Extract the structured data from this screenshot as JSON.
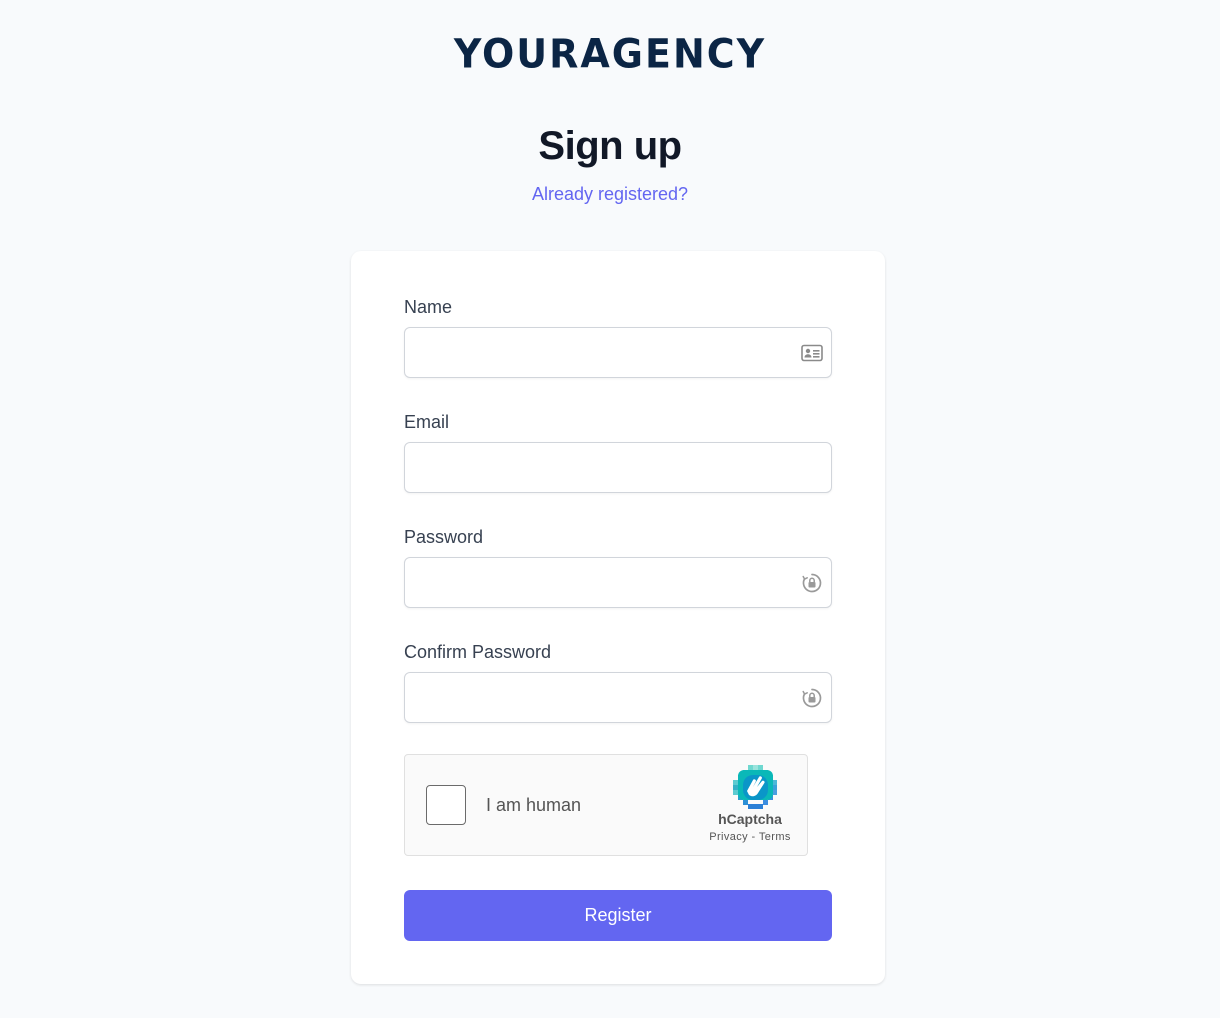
{
  "brand": {
    "logo_text": "YOURAGENCY"
  },
  "page": {
    "title": "Sign up",
    "login_link": "Already registered?"
  },
  "form": {
    "fields": [
      {
        "label": "Name",
        "value": "",
        "icon": "contact-card-icon"
      },
      {
        "label": "Email",
        "value": ""
      },
      {
        "label": "Password",
        "value": "",
        "icon": "password-manager-lock-icon"
      },
      {
        "label": "Confirm Password",
        "value": "",
        "icon": "password-manager-lock-icon"
      }
    ],
    "captcha": {
      "label": "I am human",
      "brand": "hCaptcha",
      "links": "Privacy - Terms"
    },
    "submit_label": "Register"
  },
  "colors": {
    "accent": "#6366f1",
    "background": "#f8fafc",
    "logo": "#0b2545"
  }
}
